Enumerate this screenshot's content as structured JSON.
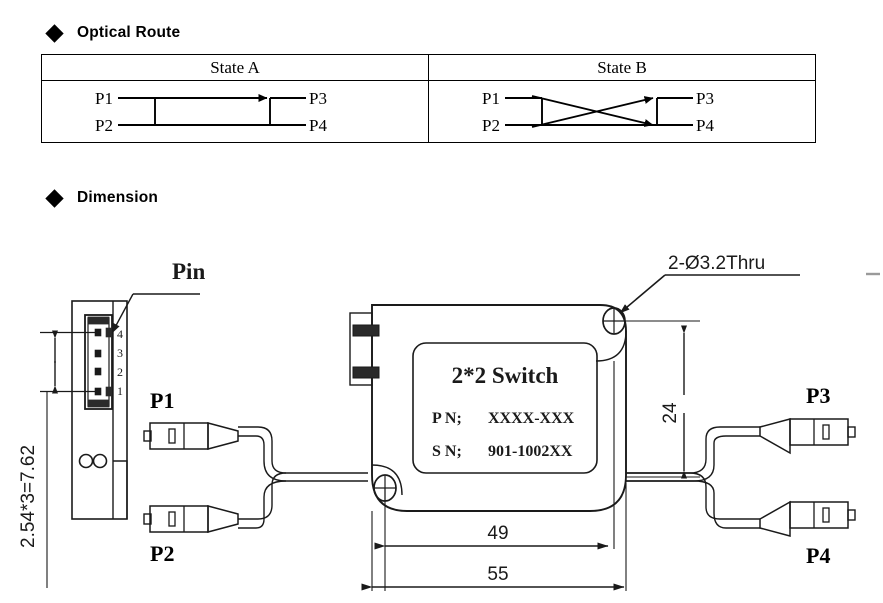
{
  "sections": {
    "optical_route": {
      "heading": "Optical Route",
      "bullet": "diamond-bullet"
    },
    "dimension": {
      "heading": "Dimension",
      "bullet": "diamond-bullet"
    }
  },
  "optical_route_table": {
    "columns": [
      {
        "header": "State A",
        "state": "A",
        "description": "bar state - straight through paths",
        "inputs": [
          "P1",
          "P2"
        ],
        "outputs": [
          "P3",
          "P4"
        ],
        "paths": [
          {
            "from": "P1",
            "to": "P3",
            "arrow": true
          },
          {
            "from": "P2",
            "to": "P4",
            "arrow": false
          }
        ]
      },
      {
        "header": "State B",
        "state": "B",
        "description": "cross state - crossed paths",
        "inputs": [
          "P1",
          "P2"
        ],
        "outputs": [
          "P3",
          "P4"
        ],
        "paths": [
          {
            "from": "P1",
            "to": "P4",
            "arrow": true
          },
          {
            "from": "P2",
            "to": "P3",
            "arrow": true
          }
        ]
      }
    ]
  },
  "drawing": {
    "labels": {
      "pin_callout": "Pin",
      "pin_numbers": [
        "4",
        "3",
        "2",
        "1"
      ],
      "port_p1": "P1",
      "port_p2": "P2",
      "port_p3": "P3",
      "port_p4": "P4",
      "hole_callout": "2-Ø3.2Thru",
      "pin_pitch_dimension": "2.54*3=7.62",
      "height_dimension": "24",
      "inner_length_dimension": "49",
      "outer_length_dimension": "55"
    },
    "device_label": {
      "title": "2*2 Switch",
      "part_number_key": "P N;",
      "part_number_value": "XXXX-XXX",
      "serial_number_key": "S N;",
      "serial_number_value": "901-1002XX"
    }
  },
  "colors": {
    "line": "#1a1a1a",
    "text": "#000000",
    "background": "#ffffff"
  }
}
